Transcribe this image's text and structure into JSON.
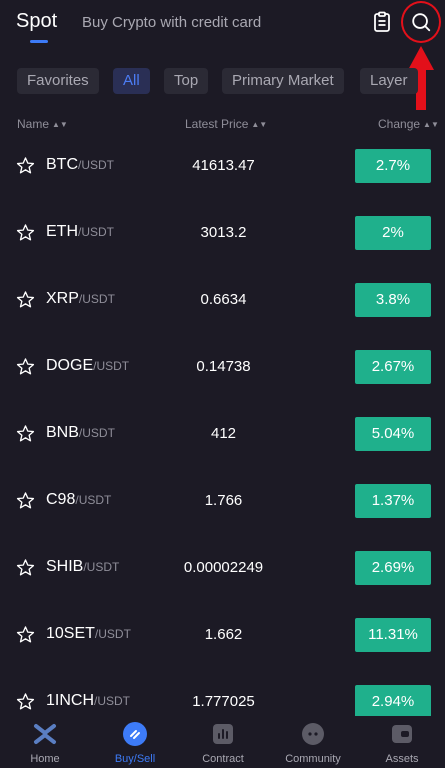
{
  "header": {
    "tab_spot": "Spot",
    "tab_buy_crypto": "Buy Crypto with credit card"
  },
  "filters": [
    "Favorites",
    "All",
    "Top",
    "Primary Market",
    "Layer"
  ],
  "active_filter": "All",
  "columns": {
    "name": "Name",
    "latest_price": "Latest Price",
    "change": "Change"
  },
  "rows": [
    {
      "symbol": "BTC",
      "quote": "/USDT",
      "price": "41613.47",
      "change": "2.7%"
    },
    {
      "symbol": "ETH",
      "quote": "/USDT",
      "price": "3013.2",
      "change": "2%"
    },
    {
      "symbol": "XRP",
      "quote": "/USDT",
      "price": "0.6634",
      "change": "3.8%"
    },
    {
      "symbol": "DOGE",
      "quote": "/USDT",
      "price": "0.14738",
      "change": "2.67%"
    },
    {
      "symbol": "BNB",
      "quote": "/USDT",
      "price": "412",
      "change": "5.04%"
    },
    {
      "symbol": "C98",
      "quote": "/USDT",
      "price": "1.766",
      "change": "1.37%"
    },
    {
      "symbol": "SHIB",
      "quote": "/USDT",
      "price": "0.00002249",
      "change": "2.69%"
    },
    {
      "symbol": "10SET",
      "quote": "/USDT",
      "price": "1.662",
      "change": "11.31%"
    },
    {
      "symbol": "1INCH",
      "quote": "/USDT",
      "price": "1.777025",
      "change": "2.94%"
    }
  ],
  "nav": {
    "home": "Home",
    "buy_sell": "Buy/Sell",
    "contract": "Contract",
    "community": "Community",
    "assets": "Assets"
  },
  "colors": {
    "background": "#1c1a25",
    "accent": "#3d7bf7",
    "positive": "#1fb08c",
    "highlight": "#e3101a"
  },
  "icons": [
    "clipboard-icon",
    "search-icon",
    "star-icon",
    "home-icon",
    "buy-sell-icon",
    "contract-icon",
    "community-icon",
    "assets-icon",
    "arrow-up-icon"
  ]
}
